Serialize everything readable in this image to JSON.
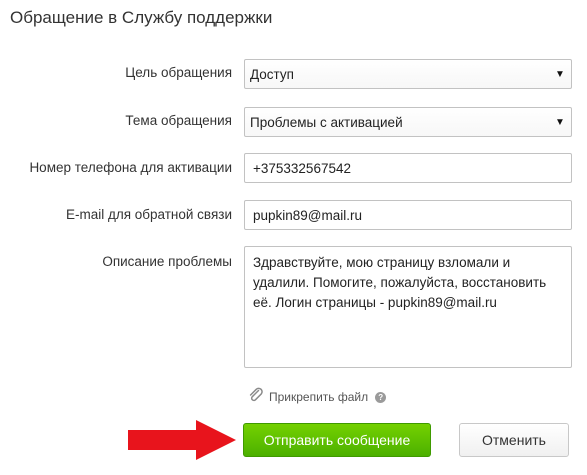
{
  "page": {
    "title": "Обращение в Службу поддержки"
  },
  "form": {
    "purpose": {
      "label": "Цель обращения",
      "value": "Доступ"
    },
    "topic": {
      "label": "Тема обращения",
      "value": "Проблемы с активацией"
    },
    "phone": {
      "label": "Номер телефона для активации",
      "value": "+375332567542"
    },
    "email": {
      "label": "E-mail для обратной связи",
      "value": "pupkin89@mail.ru"
    },
    "description": {
      "label": "Описание проблемы",
      "value": "Здравствуйте, мою страницу взломали и удалили. Помогите, пожалуйста, восстановить её. Логин страницы - pupkin89@mail.ru"
    },
    "attach": {
      "label": "Прикрепить файл",
      "help": "?"
    },
    "buttons": {
      "submit": "Отправить сообщение",
      "cancel": "Отменить"
    }
  },
  "icons": {
    "select_arrow": "dropdown-arrow-icon",
    "attach": "paperclip-icon",
    "help": "help-icon",
    "annotation": "red-arrow-icon"
  },
  "colors": {
    "submit_button": "#5cbf00",
    "annotation_arrow": "#e8141c",
    "border": "#c2c2c2"
  }
}
